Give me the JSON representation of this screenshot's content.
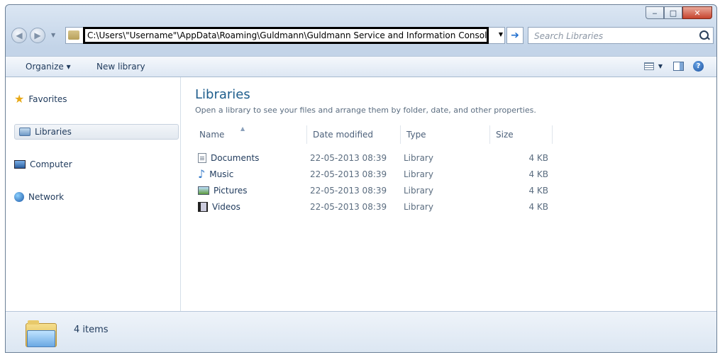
{
  "window": {
    "controls": {
      "minimize": "‒",
      "maximize": "□",
      "close": "✕"
    }
  },
  "address_bar": {
    "path": "C:\\Users\\\"Username\"\\AppData\\Roaming\\Guldmann\\Guldmann Service and Information Console",
    "go_glyph": "➔"
  },
  "search": {
    "placeholder": "Search Libraries"
  },
  "toolbar": {
    "organize_label": "Organize ▾",
    "new_library_label": "New library",
    "help_glyph": "?"
  },
  "nav": {
    "items": [
      {
        "label": "Favorites",
        "icon": "star-icon"
      },
      {
        "label": "Libraries",
        "icon": "libraries-icon",
        "selected": true
      },
      {
        "label": "Computer",
        "icon": "computer-icon"
      },
      {
        "label": "Network",
        "icon": "network-icon"
      }
    ]
  },
  "content": {
    "title": "Libraries",
    "description": "Open a library to see your files and arrange them by folder, date, and other properties.",
    "columns": [
      "Name",
      "Date modified",
      "Type",
      "Size"
    ],
    "rows": [
      {
        "name": "Documents",
        "date": "22-05-2013 08:39",
        "type": "Library",
        "size": "4 KB",
        "icon": "documents-icon"
      },
      {
        "name": "Music",
        "date": "22-05-2013 08:39",
        "type": "Library",
        "size": "4 KB",
        "icon": "music-icon"
      },
      {
        "name": "Pictures",
        "date": "22-05-2013 08:39",
        "type": "Library",
        "size": "4 KB",
        "icon": "pictures-icon"
      },
      {
        "name": "Videos",
        "date": "22-05-2013 08:39",
        "type": "Library",
        "size": "4 KB",
        "icon": "videos-icon"
      }
    ]
  },
  "details": {
    "item_count": "4 items"
  },
  "colors": {
    "title_blue": "#1e5d8c",
    "address_highlight": "#000000",
    "close_red": "#c7432d"
  }
}
